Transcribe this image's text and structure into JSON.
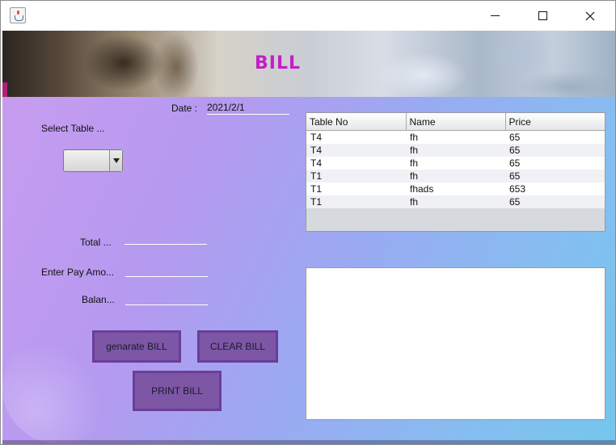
{
  "window": {
    "icon": "java-cup-icon",
    "minimize": "minimize-icon",
    "maximize": "maximize-icon",
    "close": "close-icon"
  },
  "banner": {
    "title": "BILL"
  },
  "form": {
    "date_label": "Date :",
    "date_value": "2021/2/1",
    "select_table_label": "Select Table ...",
    "select_table_value": "",
    "total_label": "Total ...",
    "total_value": "",
    "pay_label": "Enter Pay Amo...",
    "pay_value": "",
    "balance_label": "Balan...",
    "balance_value": ""
  },
  "buttons": {
    "generate": "genarate BILL",
    "clear": "CLEAR BILL",
    "print": "PRINT BILL"
  },
  "table": {
    "columns": [
      "Table No",
      "Name",
      "Price"
    ],
    "rows": [
      [
        "T4",
        "fh",
        "65"
      ],
      [
        "T4",
        "fh",
        "65"
      ],
      [
        "T4",
        "fh",
        "65"
      ],
      [
        "T1",
        "fh",
        "65"
      ],
      [
        "T1",
        "fhads",
        "653"
      ],
      [
        "T1",
        "fh",
        "65"
      ]
    ]
  },
  "bill_text": ""
}
